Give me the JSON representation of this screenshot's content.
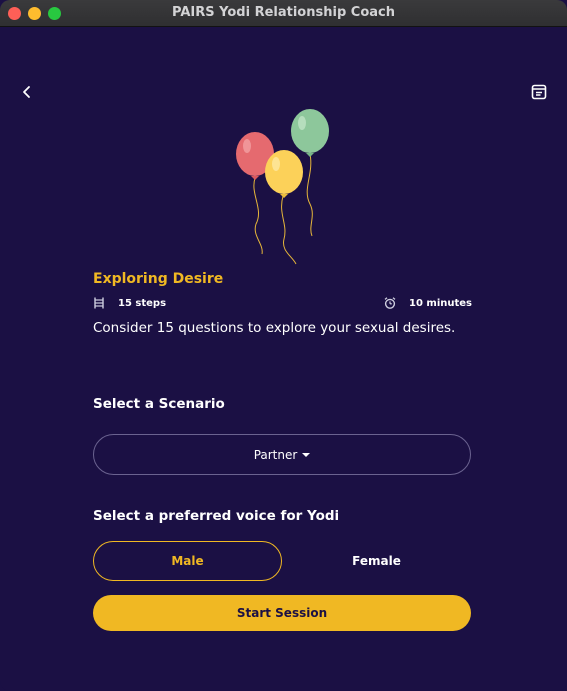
{
  "window": {
    "title": "PAIRS Yodi Relationship Coach"
  },
  "activity": {
    "title": "Exploring Desire",
    "steps": "15 steps",
    "duration": "10 minutes",
    "description": "Consider 15 questions to explore your sexual desires."
  },
  "scenario": {
    "label": "Select a Scenario",
    "selected": "Partner"
  },
  "voice": {
    "label": "Select a preferred voice for Yodi",
    "options": [
      "Male",
      "Female"
    ],
    "selected": "Male"
  },
  "actions": {
    "start": "Start Session"
  },
  "colors": {
    "background": "#1b1044",
    "accent": "#f0b823",
    "text": "#ffffff"
  },
  "icons": {
    "back": "chevron-left-icon",
    "notes": "notes-icon",
    "steps": "ladder-icon",
    "duration": "alarm-clock-icon",
    "illustration": "balloons-illustration"
  }
}
